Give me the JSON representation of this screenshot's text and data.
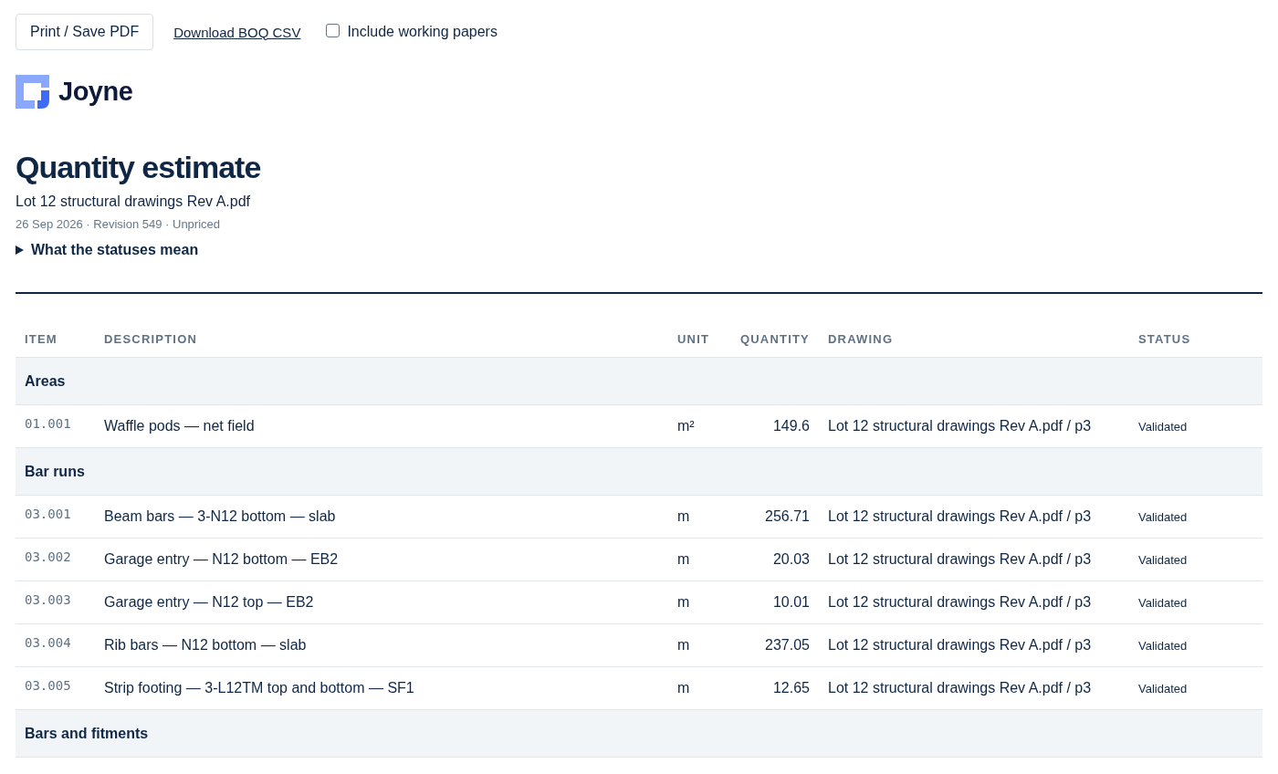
{
  "toolbar": {
    "print_button": "Print / Save PDF",
    "download_link": "Download BOQ CSV",
    "include_working_papers": {
      "label": "Include working papers",
      "checked": false
    }
  },
  "brand": {
    "name": "Joyne"
  },
  "title": "Quantity estimate",
  "file_name": "Lot 12 structural drawings Rev A.pdf",
  "meta": "26 Sep 2026 · Revision 549 · Unpriced",
  "statuses_details": {
    "label": "What the statuses mean",
    "expanded": false
  },
  "table": {
    "columns": [
      "ITEM",
      "DESCRIPTION",
      "UNIT",
      "QUANTITY",
      "DRAWING",
      "STATUS"
    ],
    "rows": [
      {
        "kind": "group",
        "label": "Areas"
      },
      {
        "kind": "item",
        "item": "01.001",
        "description": "Waffle pods — net field",
        "unit": "m²",
        "quantity": "149.6",
        "drawing": "Lot 12 structural drawings Rev A.pdf / p3",
        "status": "Validated"
      },
      {
        "kind": "group",
        "label": "Bar runs"
      },
      {
        "kind": "item",
        "item": "03.001",
        "description": "Beam bars — 3-N12 bottom — slab",
        "unit": "m",
        "quantity": "256.71",
        "drawing": "Lot 12 structural drawings Rev A.pdf / p3",
        "status": "Validated"
      },
      {
        "kind": "item",
        "item": "03.002",
        "description": "Garage entry — N12 bottom — EB2",
        "unit": "m",
        "quantity": "20.03",
        "drawing": "Lot 12 structural drawings Rev A.pdf / p3",
        "status": "Validated"
      },
      {
        "kind": "item",
        "item": "03.003",
        "description": "Garage entry — N12 top — EB2",
        "unit": "m",
        "quantity": "10.01",
        "drawing": "Lot 12 structural drawings Rev A.pdf / p3",
        "status": "Validated"
      },
      {
        "kind": "item",
        "item": "03.004",
        "description": "Rib bars — N12 bottom — slab",
        "unit": "m",
        "quantity": "237.05",
        "drawing": "Lot 12 structural drawings Rev A.pdf / p3",
        "status": "Validated"
      },
      {
        "kind": "item",
        "item": "03.005",
        "description": "Strip footing — 3-L12TM top and bottom — SF1",
        "unit": "m",
        "quantity": "12.65",
        "drawing": "Lot 12 structural drawings Rev A.pdf / p3",
        "status": "Validated"
      },
      {
        "kind": "group",
        "label": "Bars and fitments"
      }
    ]
  }
}
